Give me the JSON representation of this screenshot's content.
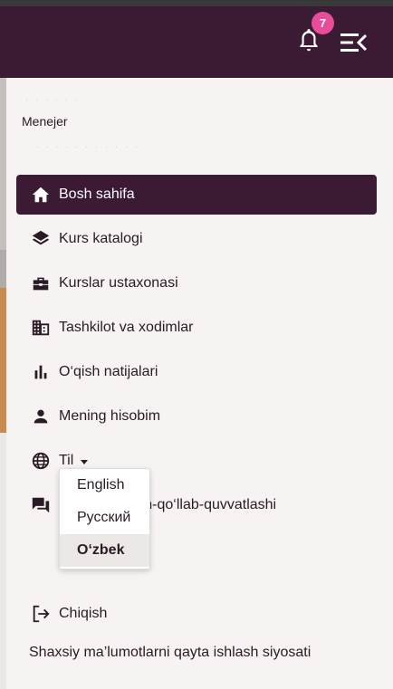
{
  "header": {
    "notification_count": "7",
    "bell_icon": "bell-icon",
    "menu_close_icon": "menu-collapse-icon",
    "bg_color": "#3b1b34",
    "badge_color": "#e94c9b"
  },
  "user": {
    "role": "Menejer"
  },
  "nav": {
    "items": [
      {
        "label": "Bosh sahifa",
        "icon": "home-icon"
      },
      {
        "label": "Kurs katalogi",
        "icon": "layers-icon"
      },
      {
        "label": "Kurslar ustaxonasi",
        "icon": "toolbox-icon"
      },
      {
        "label": "Tashkilot va xodimlar",
        "icon": "building-icon"
      },
      {
        "label": "O‘qish natijalari",
        "icon": "bar-chart-icon"
      },
      {
        "label": "Mening hisobim",
        "icon": "person-icon"
      },
      {
        "label": "Til",
        "icon": "globe-icon"
      },
      {
        "label": "Texnik yordam-qo‘llab-quvvatlashi",
        "icon": "chat-icon"
      },
      {
        "label": "Chiqish",
        "icon": "logout-icon"
      }
    ],
    "active_index": 0
  },
  "language_dropdown": {
    "options": [
      "English",
      "Русский",
      "O‘zbek"
    ],
    "selected": "O‘zbek"
  },
  "footer": {
    "policy_link": "Shaxsiy ma’lumotlarni qayta ishlash siyosati"
  }
}
